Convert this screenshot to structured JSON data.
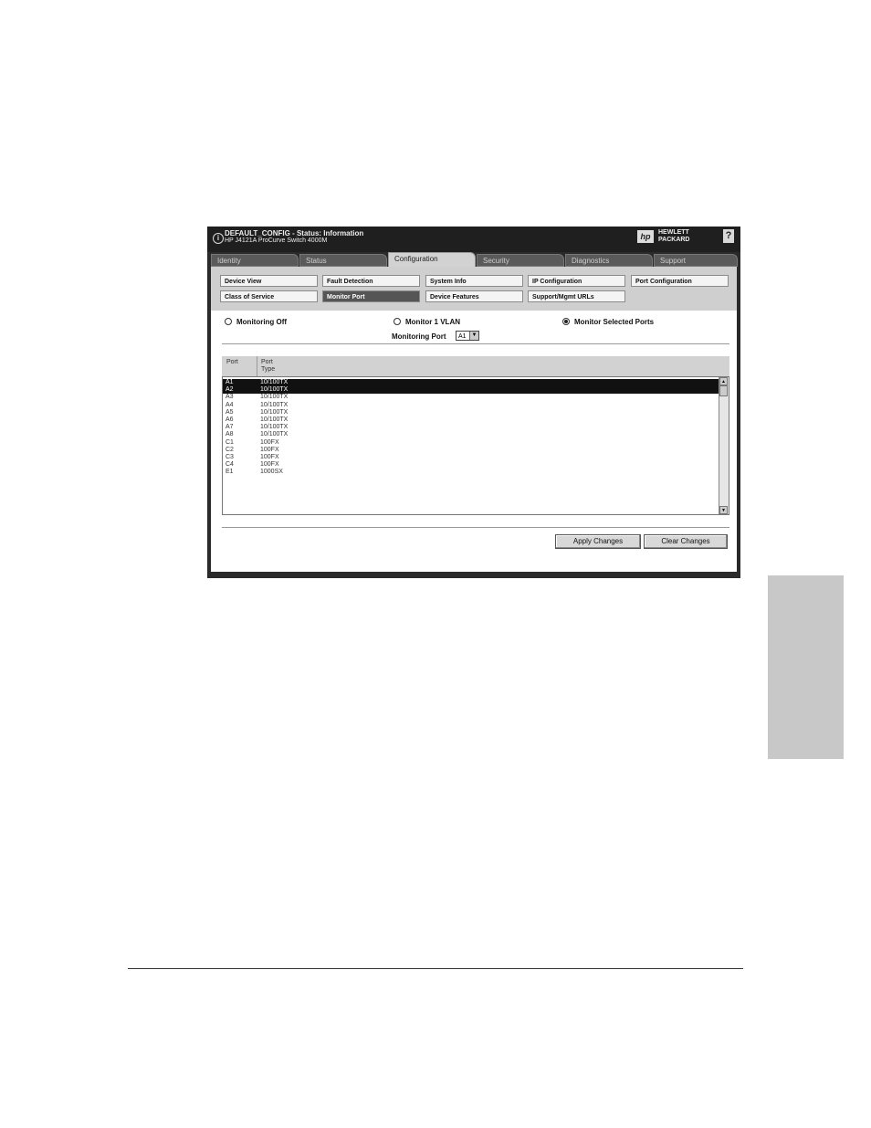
{
  "header": {
    "title_line1": "DEFAULT_CONFIG - Status: Information",
    "title_line2": "HP J4121A ProCurve Switch 4000M",
    "brand_line1": "HEWLETT",
    "brand_line2": "PACKARD",
    "help_label": "?",
    "logo_glyph": "hp"
  },
  "tabs": [
    {
      "label": "Identity"
    },
    {
      "label": "Status"
    },
    {
      "label": "Configuration",
      "active": true
    },
    {
      "label": "Security"
    },
    {
      "label": "Diagnostics"
    },
    {
      "label": "Support"
    }
  ],
  "subnav": {
    "row1": [
      "Device View",
      "Fault Detection",
      "System Info",
      "IP Configuration",
      "Port Configuration"
    ],
    "row2": [
      "Class of Service",
      "Monitor Port",
      "Device Features",
      "Support/Mgmt URLs"
    ],
    "active": "Monitor Port"
  },
  "options": {
    "monitoring_off": "Monitoring Off",
    "monitor_vlan": "Monitor 1 VLAN",
    "monitor_selected": "Monitor Selected Ports",
    "selected_option": "monitor_selected",
    "monitoring_port_label": "Monitoring Port",
    "monitoring_port_value": "A1"
  },
  "table": {
    "col_port": "Port",
    "col_type_line1": "Port",
    "col_type_line2": "Type",
    "rows": [
      {
        "port": "A1",
        "type": "10/100TX",
        "selected": true
      },
      {
        "port": "A2",
        "type": "10/100TX",
        "selected": true
      },
      {
        "port": "A3",
        "type": "10/100TX"
      },
      {
        "port": "A4",
        "type": "10/100TX"
      },
      {
        "port": "A5",
        "type": "10/100TX"
      },
      {
        "port": "A6",
        "type": "10/100TX"
      },
      {
        "port": "A7",
        "type": "10/100TX"
      },
      {
        "port": "A8",
        "type": "10/100TX"
      },
      {
        "port": "C1",
        "type": "100FX"
      },
      {
        "port": "C2",
        "type": "100FX"
      },
      {
        "port": "C3",
        "type": "100FX"
      },
      {
        "port": "C4",
        "type": "100FX"
      },
      {
        "port": "E1",
        "type": "1000SX"
      }
    ]
  },
  "buttons": {
    "apply": "Apply Changes",
    "clear": "Clear Changes"
  },
  "icons": {
    "info": "info-icon",
    "help": "help-icon",
    "logo": "hp-logo-icon",
    "dropdown": "chevron-down-icon",
    "scroll_up": "scroll-up-icon",
    "scroll_down": "scroll-down-icon"
  }
}
